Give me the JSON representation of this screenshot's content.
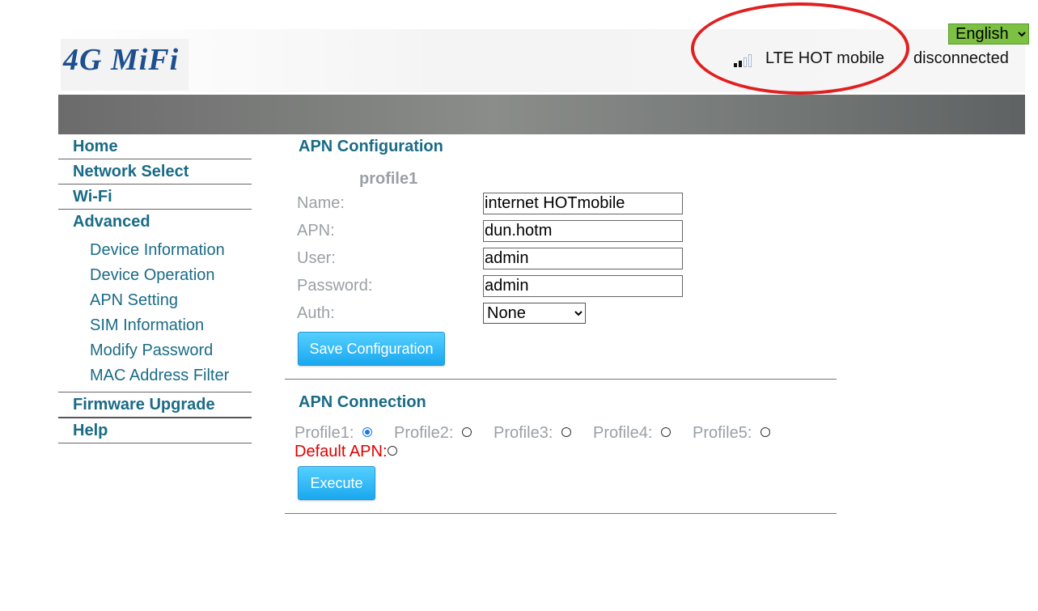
{
  "header": {
    "logo_text": "4G MiFi",
    "language": "English",
    "network": "LTE HOT mobile",
    "connection_status": "disconnected",
    "signal_bars": 2,
    "signal_bars_total": 4
  },
  "sidebar": {
    "items": [
      {
        "label": "Home"
      },
      {
        "label": "Network Select"
      },
      {
        "label": "Wi-Fi"
      },
      {
        "label": "Advanced"
      }
    ],
    "advanced_items": [
      {
        "label": "Device Information"
      },
      {
        "label": "Device Operation"
      },
      {
        "label": "APN Setting"
      },
      {
        "label": "SIM Information"
      },
      {
        "label": "Modify Password"
      },
      {
        "label": "MAC Address Filter"
      }
    ],
    "bottom_items": [
      {
        "label": "Firmware Upgrade"
      },
      {
        "label": "Help"
      }
    ]
  },
  "apn_config": {
    "title": "APN Configuration",
    "profile_label": "profile1",
    "name_label": "Name:",
    "name_value": "internet HOTmobile",
    "apn_label": "APN:",
    "apn_value": "dun.hotm",
    "user_label": "User:",
    "user_value": "admin",
    "password_label": "Password:",
    "password_value": "admin",
    "auth_label": "Auth:",
    "auth_value": "None",
    "save_button": "Save Configuration"
  },
  "apn_connection": {
    "title": "APN Connection",
    "profiles": [
      "Profile1:",
      "Profile2:",
      "Profile3:",
      "Profile4:",
      "Profile5:"
    ],
    "selected": "Profile1:",
    "default_apn_label": "Default APN:",
    "execute_button": "Execute"
  },
  "colors": {
    "accent": "#1a6b86",
    "muted": "#9aa0a6",
    "button": "#1aa8ef",
    "highlight_circle": "#e02020",
    "language_bg": "#7dc142",
    "default_apn": "#e00000"
  }
}
